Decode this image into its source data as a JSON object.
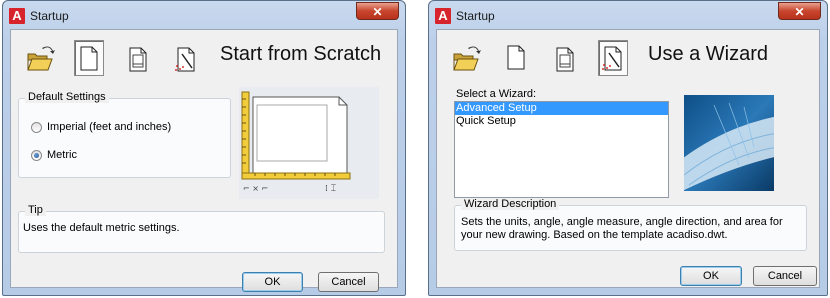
{
  "windows": [
    {
      "title": "Startup",
      "mode_title": "Start from Scratch",
      "toolbar": [
        "open-drawing-icon",
        "start-from-scratch-icon",
        "use-template-icon",
        "use-wizard-icon"
      ],
      "settings": {
        "label": "Default Settings",
        "options": [
          "Imperial (feet and inches)",
          "Metric"
        ],
        "selected": "Metric"
      },
      "tip": {
        "label": "Tip",
        "text": "Uses the default metric settings."
      },
      "buttons": {
        "ok": "OK",
        "cancel": "Cancel"
      }
    },
    {
      "title": "Startup",
      "mode_title": "Use a Wizard",
      "toolbar": [
        "open-drawing-icon",
        "start-from-scratch-icon",
        "use-template-icon",
        "use-wizard-icon"
      ],
      "wizard_select_label": "Select a Wizard:",
      "wizards": [
        "Advanced Setup",
        "Quick Setup"
      ],
      "selected_wizard": "Advanced Setup",
      "description": {
        "label": "Wizard Description",
        "text": "Sets the units, angle, angle measure, angle direction, and area for your new drawing. Based on the template acadiso.dwt."
      },
      "buttons": {
        "ok": "OK",
        "cancel": "Cancel"
      }
    }
  ],
  "colors": {
    "selection": "#3399ff",
    "logo": "#d6232c",
    "close": "#c8452d"
  }
}
